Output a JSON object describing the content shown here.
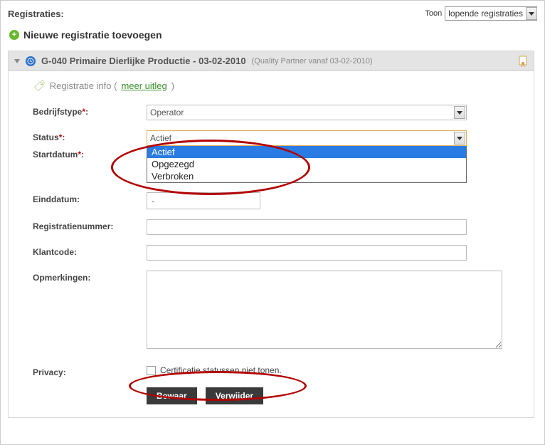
{
  "topbar": {
    "title": "Registraties:",
    "toon_label": "Toon",
    "toon_value": "lopende registraties"
  },
  "add": {
    "label": "Nieuwe registratie toevoegen"
  },
  "panel": {
    "title_main": "G-040 Primaire Dierlijke Productie - 03-02-2010",
    "title_sub": "(Quality Partner vanaf 03-02-2010)"
  },
  "section": {
    "prefix": "Registratie info (",
    "link": "meer uitleg",
    "suffix": ")"
  },
  "form": {
    "bedrijfstype": {
      "label": "Bedrijfstype",
      "value": "Operator"
    },
    "status": {
      "label": "Status",
      "value": "Actief",
      "options": [
        "Actief",
        "Opgezegd",
        "Verbroken"
      ]
    },
    "startdatum": {
      "label": "Startdatum"
    },
    "einddatum": {
      "label": "Einddatum:",
      "value": "-"
    },
    "registratienummer": {
      "label": "Registratienummer:"
    },
    "klantcode": {
      "label": "Klantcode:"
    },
    "opmerkingen": {
      "label": "Opmerkingen:"
    },
    "privacy": {
      "label": "Privacy:",
      "checkbox_label": "Certificatie statussen niet tonen."
    }
  },
  "buttons": {
    "save": "Bewaar",
    "delete": "Verwijder"
  }
}
